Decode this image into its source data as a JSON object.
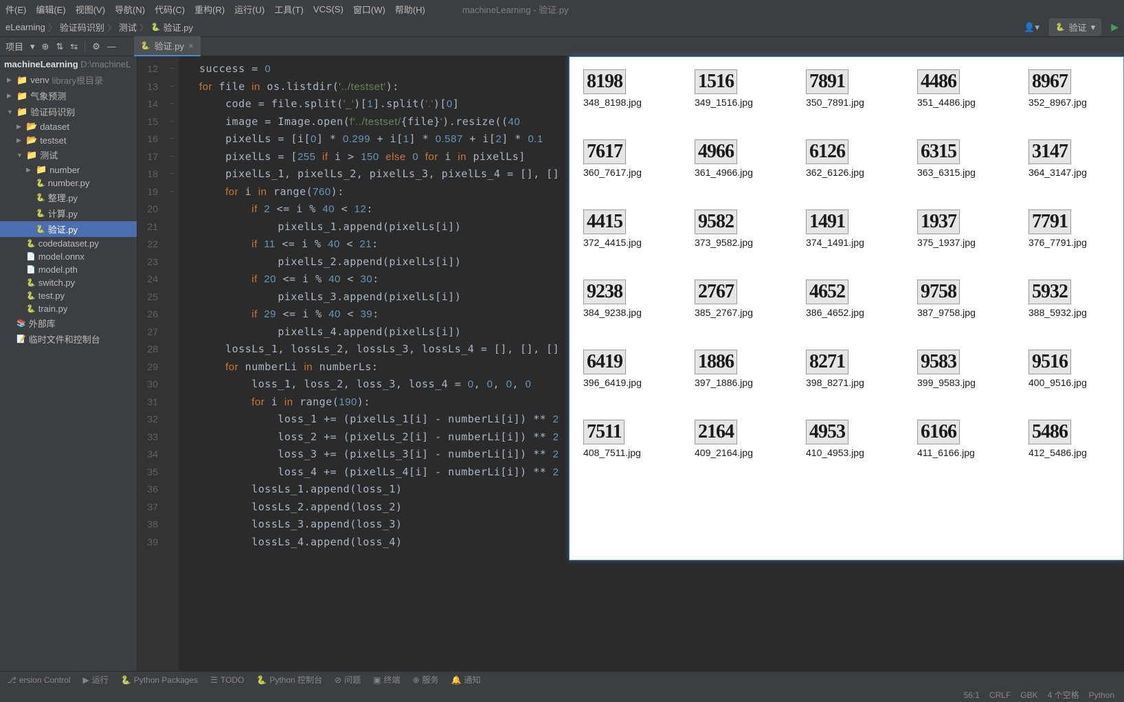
{
  "window_title": "machineLearning - 验证.py",
  "menubar": [
    "件(E)",
    "编辑(E)",
    "视图(V)",
    "导航(N)",
    "代码(C)",
    "重构(R)",
    "运行(U)",
    "工具(T)",
    "VCS(S)",
    "窗口(W)",
    "帮助(H)"
  ],
  "breadcrumb": [
    "eLearning",
    "验证码识别",
    "测试",
    "验证.py"
  ],
  "run_config": "验证",
  "toolbar_label": "项目",
  "tab": {
    "name": "验证.py"
  },
  "project": {
    "name": "machineLearning",
    "path": "D:\\machineL",
    "tree": [
      {
        "d": 1,
        "icon": "folder",
        "label": "venv",
        "note": "library根目录",
        "arrow": "▶",
        "cls": ""
      },
      {
        "d": 1,
        "icon": "folder",
        "label": "气象预测",
        "arrow": "▶"
      },
      {
        "d": 1,
        "icon": "folder",
        "label": "验证码识别",
        "arrow": "▼"
      },
      {
        "d": 2,
        "icon": "folder-o",
        "label": "dataset",
        "arrow": "▶"
      },
      {
        "d": 2,
        "icon": "folder-o",
        "label": "testset",
        "arrow": "▶"
      },
      {
        "d": 2,
        "icon": "folder",
        "label": "测试",
        "arrow": "▼"
      },
      {
        "d": 3,
        "icon": "folder",
        "label": "number",
        "arrow": "▶"
      },
      {
        "d": 3,
        "icon": "py",
        "label": "number.py"
      },
      {
        "d": 3,
        "icon": "py",
        "label": "整理.py"
      },
      {
        "d": 3,
        "icon": "py",
        "label": "计算.py"
      },
      {
        "d": 3,
        "icon": "py",
        "label": "验证.py",
        "selected": true
      },
      {
        "d": 2,
        "icon": "py",
        "label": "codedataset.py"
      },
      {
        "d": 2,
        "icon": "file",
        "label": "model.onnx"
      },
      {
        "d": 2,
        "icon": "file",
        "label": "model.pth"
      },
      {
        "d": 2,
        "icon": "py",
        "label": "switch.py"
      },
      {
        "d": 2,
        "icon": "py",
        "label": "test.py"
      },
      {
        "d": 2,
        "icon": "py",
        "label": "train.py"
      },
      {
        "d": 1,
        "icon": "lib",
        "label": "外部库"
      },
      {
        "d": 1,
        "icon": "scratch",
        "label": "临时文件和控制台"
      }
    ]
  },
  "line_start": 12,
  "line_end": 39,
  "fold_marks": {
    "0": "−",
    "1": "−",
    "7": "−",
    "8": "−",
    "12": "−",
    "14": "−",
    "16": "−",
    "18": "−"
  },
  "code_lines": [
    "success = <span class='num'>0</span>",
    "<span class='kw'>for</span> file <span class='kw'>in</span> os.listdir(<span class='str'>'../testset'</span>):",
    "    code = file.split(<span class='str'>'_'</span>)[<span class='num'>1</span>].split(<span class='str'>'.'</span>)[<span class='num'>0</span>]",
    "    image = Image.open(<span class='str'>f'../testset/</span>{file}<span class='str'>'</span>).resize((<span class='num'>40</span>",
    "    pixelLs = [i[<span class='num'>0</span>] * <span class='num'>0.299</span> + i[<span class='num'>1</span>] * <span class='num'>0.587</span> + i[<span class='num'>2</span>] * <span class='num'>0.1</span>",
    "    pixelLs = [<span class='num'>255</span> <span class='kw'>if</span> i &gt; <span class='num'>150</span> <span class='kw'>else</span> <span class='num'>0</span> <span class='kw'>for</span> i <span class='kw'>in</span> pixelLs]",
    "    pixelLs_1, pixelLs_2, pixelLs_3, pixelLs_4 = [], []",
    "    <span class='kw'>for</span> i <span class='kw'>in</span> range(<span class='num'>760</span>):",
    "        <span class='kw'>if</span> <span class='num'>2</span> &lt;= i % <span class='num'>40</span> &lt; <span class='num'>12</span>:",
    "            pixelLs_1.append(pixelLs[i])",
    "        <span class='kw'>if</span> <span class='num'>11</span> &lt;= i % <span class='num'>40</span> &lt; <span class='num'>21</span>:",
    "            pixelLs_2.append(pixelLs[i])",
    "        <span class='kw'>if</span> <span class='num'>20</span> &lt;= i % <span class='num'>40</span> &lt; <span class='num'>30</span>:",
    "            pixelLs_3.append(pixelLs[i])",
    "        <span class='kw'>if</span> <span class='num'>29</span> &lt;= i % <span class='num'>40</span> &lt; <span class='num'>39</span>:",
    "            pixelLs_4.append(pixelLs[i])",
    "    lossLs_1, lossLs_2, lossLs_3, lossLs_4 = [], [], []",
    "    <span class='kw'>for</span> numberLi <span class='kw'>in</span> numberLs:",
    "        loss_1, loss_2, loss_3, loss_4 = <span class='num'>0</span>, <span class='num'>0</span>, <span class='num'>0</span>, <span class='num'>0</span>",
    "        <span class='kw'>for</span> i <span class='kw'>in</span> range(<span class='num'>190</span>):",
    "            loss_1 += (pixelLs_1[i] - numberLi[i]) ** <span class='num'>2</span>",
    "            loss_2 += (pixelLs_2[i] - numberLi[i]) ** <span class='num'>2</span>",
    "            loss_3 += (pixelLs_3[i] - numberLi[i]) ** <span class='num'>2</span>",
    "            loss_4 += (pixelLs_4[i] - numberLi[i]) ** <span class='num'>2</span>",
    "        lossLs_1.append(loss_1)",
    "        lossLs_2.append(loss_2)",
    "        lossLs_3.append(loss_3)",
    "        lossLs_4.append(loss_4)"
  ],
  "thumbnails": [
    {
      "num": "8198",
      "name": "348_8198.jpg"
    },
    {
      "num": "1516",
      "name": "349_1516.jpg"
    },
    {
      "num": "7891",
      "name": "350_7891.jpg"
    },
    {
      "num": "4486",
      "name": "351_4486.jpg"
    },
    {
      "num": "8967",
      "name": "352_8967.jpg"
    },
    {
      "num": "7617",
      "name": "360_7617.jpg"
    },
    {
      "num": "4966",
      "name": "361_4966.jpg"
    },
    {
      "num": "6126",
      "name": "362_6126.jpg"
    },
    {
      "num": "6315",
      "name": "363_6315.jpg"
    },
    {
      "num": "3147",
      "name": "364_3147.jpg"
    },
    {
      "num": "4415",
      "name": "372_4415.jpg"
    },
    {
      "num": "9582",
      "name": "373_9582.jpg"
    },
    {
      "num": "1491",
      "name": "374_1491.jpg"
    },
    {
      "num": "1937",
      "name": "375_1937.jpg"
    },
    {
      "num": "7791",
      "name": "376_7791.jpg"
    },
    {
      "num": "9238",
      "name": "384_9238.jpg"
    },
    {
      "num": "2767",
      "name": "385_2767.jpg"
    },
    {
      "num": "4652",
      "name": "386_4652.jpg"
    },
    {
      "num": "9758",
      "name": "387_9758.jpg"
    },
    {
      "num": "5932",
      "name": "388_5932.jpg"
    },
    {
      "num": "6419",
      "name": "396_6419.jpg"
    },
    {
      "num": "1886",
      "name": "397_1886.jpg"
    },
    {
      "num": "8271",
      "name": "398_8271.jpg"
    },
    {
      "num": "9583",
      "name": "399_9583.jpg"
    },
    {
      "num": "9516",
      "name": "400_9516.jpg"
    },
    {
      "num": "7511",
      "name": "408_7511.jpg"
    },
    {
      "num": "2164",
      "name": "409_2164.jpg"
    },
    {
      "num": "4953",
      "name": "410_4953.jpg"
    },
    {
      "num": "6166",
      "name": "411_6166.jpg"
    },
    {
      "num": "5486",
      "name": "412_5486.jpg"
    }
  ],
  "bottombar": [
    {
      "icon": "⎇",
      "label": "ersion Control"
    },
    {
      "icon": "▶",
      "label": "运行"
    },
    {
      "icon": "🐍",
      "label": "Python Packages"
    },
    {
      "icon": "☰",
      "label": "TODO"
    },
    {
      "icon": "🐍",
      "label": "Python 控制台"
    },
    {
      "icon": "⊘",
      "label": "问题"
    },
    {
      "icon": "▣",
      "label": "终端"
    },
    {
      "icon": "⊕",
      "label": "服务"
    },
    {
      "icon": "🔔",
      "label": "通知"
    }
  ],
  "statusbar": {
    "pos": "56:1",
    "eol": "CRLF",
    "enc": "GBK",
    "indent": "4 个空格",
    "lang": "Python"
  }
}
